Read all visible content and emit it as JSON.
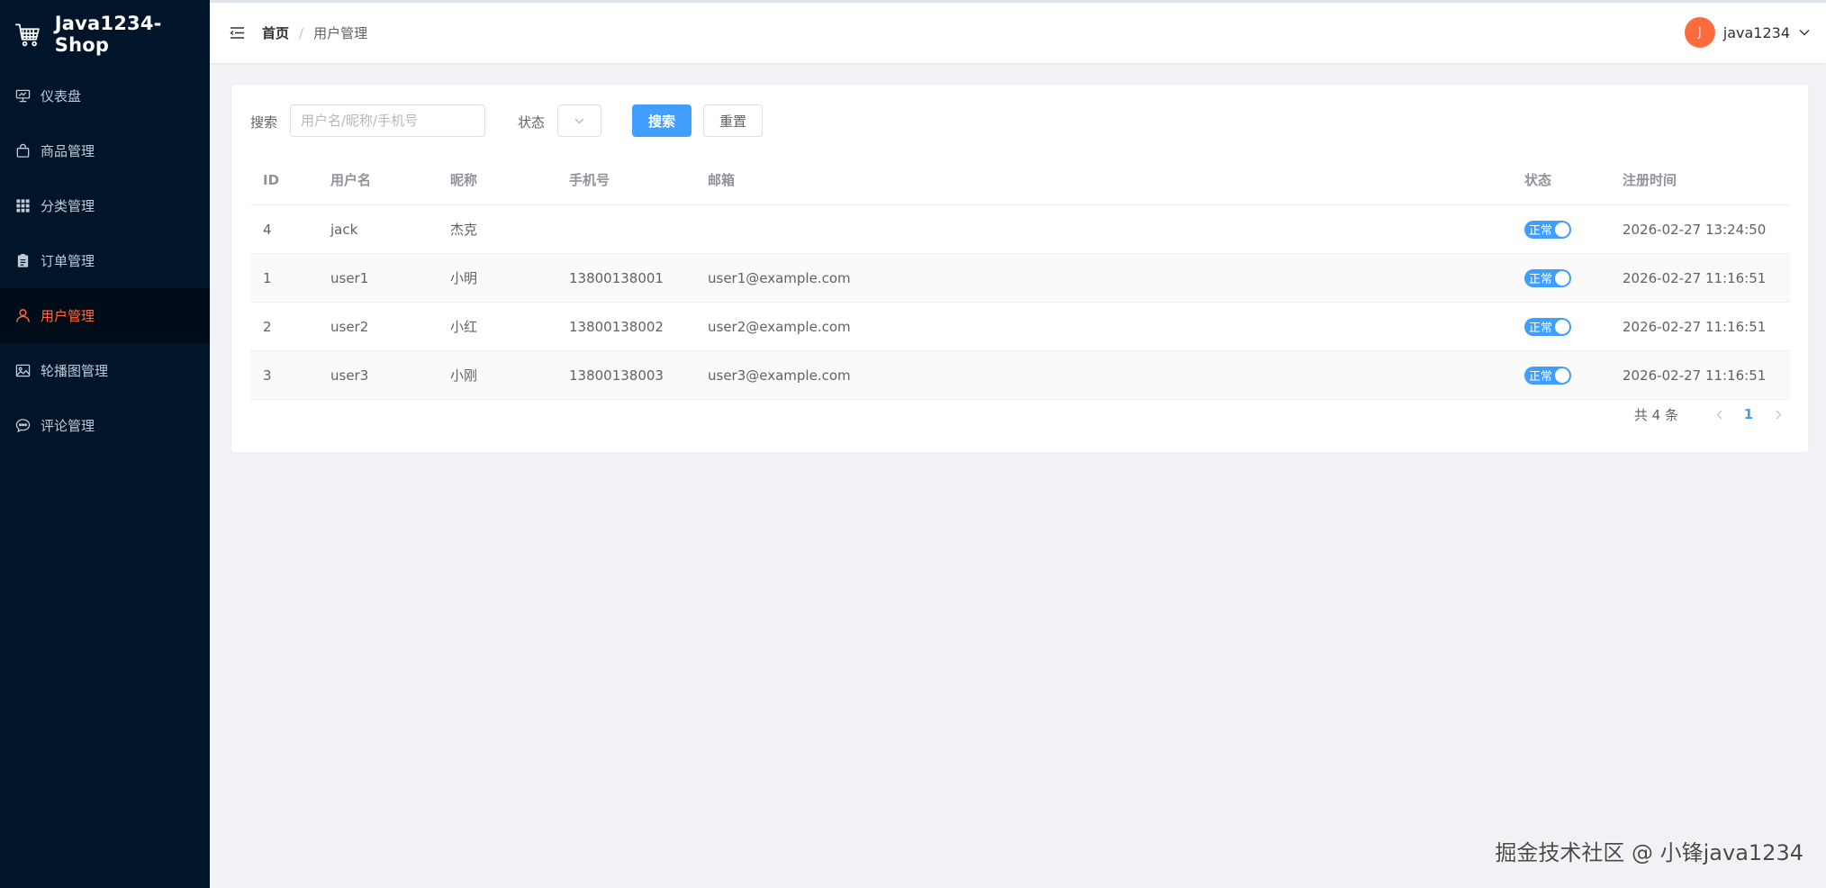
{
  "app": {
    "title": "Java1234-Shop",
    "logo_icon": "shopping-cart-icon"
  },
  "sidebar": {
    "items": [
      {
        "label": "仪表盘",
        "icon": "dashboard-icon",
        "active": false
      },
      {
        "label": "商品管理",
        "icon": "shopping-bag-icon",
        "active": false
      },
      {
        "label": "分类管理",
        "icon": "grid-icon",
        "active": false
      },
      {
        "label": "订单管理",
        "icon": "clipboard-icon",
        "active": false
      },
      {
        "label": "用户管理",
        "icon": "user-icon",
        "active": true
      },
      {
        "label": "轮播图管理",
        "icon": "picture-icon",
        "active": false
      },
      {
        "label": "评论管理",
        "icon": "chat-icon",
        "active": false
      }
    ],
    "colors": {
      "background": "#001529",
      "active_text": "#ff6b3d"
    }
  },
  "header": {
    "breadcrumb": {
      "home": "首页",
      "separator": "/",
      "current": "用户管理"
    },
    "user": {
      "avatar_letter": "J",
      "name": "java1234"
    }
  },
  "search": {
    "label": "搜索",
    "placeholder": "用户名/昵称/手机号",
    "value": "",
    "status_label": "状态",
    "status_value": "",
    "search_button": "搜索",
    "reset_button": "重置"
  },
  "table": {
    "columns": {
      "id": "ID",
      "username": "用户名",
      "nickname": "昵称",
      "phone": "手机号",
      "email": "邮箱",
      "status": "状态",
      "registered": "注册时间"
    },
    "rows": [
      {
        "id": "4",
        "username": "jack",
        "nickname": "杰克",
        "phone": "",
        "email": "",
        "status": "正常",
        "enabled": true,
        "registered": "2026-02-27 13:24:50"
      },
      {
        "id": "1",
        "username": "user1",
        "nickname": "小明",
        "phone": "13800138001",
        "email": "user1@example.com",
        "status": "正常",
        "enabled": true,
        "registered": "2026-02-27 11:16:51"
      },
      {
        "id": "2",
        "username": "user2",
        "nickname": "小红",
        "phone": "13800138002",
        "email": "user2@example.com",
        "status": "正常",
        "enabled": true,
        "registered": "2026-02-27 11:16:51"
      },
      {
        "id": "3",
        "username": "user3",
        "nickname": "小刚",
        "phone": "13800138003",
        "email": "user3@example.com",
        "status": "正常",
        "enabled": true,
        "registered": "2026-02-27 11:16:51"
      }
    ]
  },
  "pagination": {
    "total_text": "共 4 条",
    "current_page": "1"
  },
  "watermark": "掘金技术社区 @ 小锋java1234",
  "colors": {
    "primary": "#409eff",
    "accent": "#ff6b3d"
  }
}
